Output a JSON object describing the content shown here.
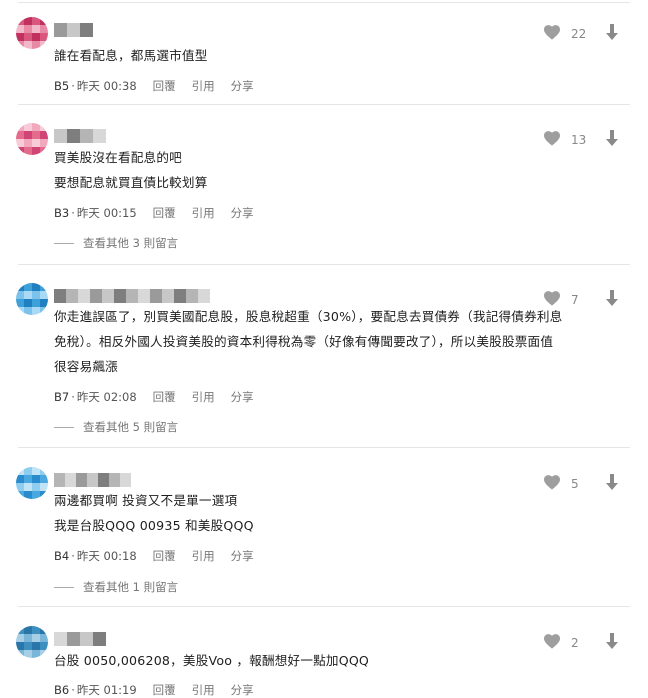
{
  "comments": [
    {
      "floor": "B5",
      "time": "昨天 00:38",
      "likes": "22",
      "lines": [
        "誰在看配息，都馬選市值型"
      ],
      "more": "",
      "avatar_colors": [
        "#d9577f",
        "#e88aa5",
        "#c2305f",
        "#f2b8c9"
      ]
    },
    {
      "floor": "B3",
      "time": "昨天 00:15",
      "likes": "13",
      "lines": [
        "買美股沒在看配息的吧",
        "要想配息就買直債比較划算"
      ],
      "more": "查看其他 3 則留言",
      "avatar_colors": [
        "#e56b8d",
        "#f3a9bd",
        "#d04575",
        "#f7cbd7"
      ]
    },
    {
      "floor": "B7",
      "time": "昨天 02:08",
      "likes": "7",
      "lines": [
        "你走進誤區了，別買美國配息股，股息稅超重（30%），要配息去買債券（我記得債券利息",
        "免稅）。相反外國人投資美股的資本利得稅為零（好像有傳聞要改了），所以美股股票面值",
        "很容易飆漲"
      ],
      "more": "查看其他 5 則留言",
      "avatar_colors": [
        "#3ea0d8",
        "#7cc3ec",
        "#1f7fc0",
        "#a9d9f4"
      ]
    },
    {
      "floor": "B4",
      "time": "昨天 00:18",
      "likes": "5",
      "lines": [
        "兩邊都買啊 投資又不是單一選項",
        "我是台股QQQ 00935 和美股QQQ"
      ],
      "more": "查看其他 1 則留言",
      "avatar_colors": [
        "#4aa8e0",
        "#8fcdf0",
        "#2b8ccd",
        "#bfe3f7"
      ]
    },
    {
      "floor": "B6",
      "time": "昨天 01:19",
      "likes": "2",
      "lines": [
        "台股 0050,006208，美股Voo ，報酬想好一點加QQQ"
      ],
      "more": "",
      "avatar_colors": [
        "#3d8fc0",
        "#79b6d9",
        "#2a76a8",
        "#a6cfe6"
      ]
    }
  ],
  "actions": {
    "reply": "回覆",
    "quote": "引用",
    "share": "分享"
  },
  "icons": {
    "like": "heart-icon",
    "down": "arrow-down-icon"
  },
  "colors": {
    "icon": "#9e9e9e",
    "divider": "#e6e6e6"
  }
}
